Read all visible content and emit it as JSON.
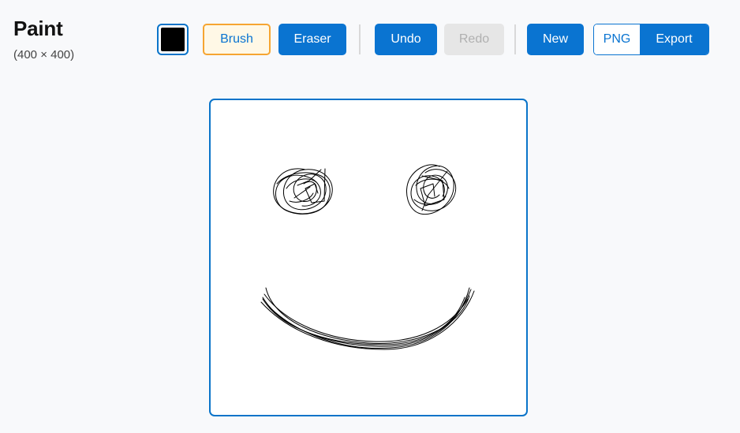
{
  "app": {
    "title": "Paint",
    "dimensions": "(400 × 400)"
  },
  "toolbar": {
    "color_swatch": {
      "color": "#000000",
      "accent": "#0a74c9"
    },
    "tools": [
      {
        "id": "brush",
        "label": "Brush",
        "selected": true
      },
      {
        "id": "eraser",
        "label": "Eraser",
        "selected": false
      }
    ],
    "undo_label": "Undo",
    "redo_label": "Redo",
    "redo_disabled": true,
    "new_label": "New",
    "format_label": "PNG",
    "export_label": "Export"
  },
  "canvas": {
    "width": 400,
    "height": 400,
    "background": "#ffffff",
    "stroke_color": "#000000",
    "drawing": "smiley face sketch"
  },
  "colors": {
    "primary": "#0a74d1",
    "selected_border": "#f6a531",
    "selected_bg": "#fff8e6",
    "disabled_bg": "#e6e6e6",
    "disabled_text": "#b0b0b0",
    "page_bg": "#f8f9fb"
  }
}
